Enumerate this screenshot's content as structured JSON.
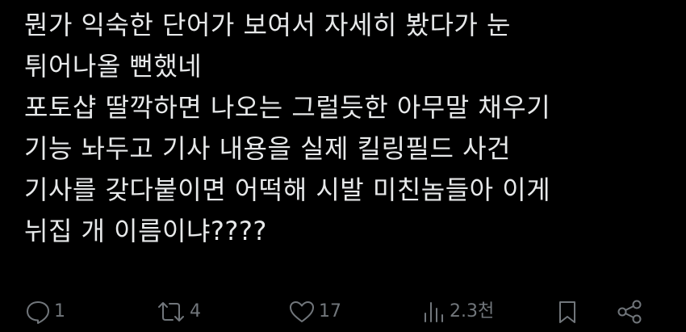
{
  "post": {
    "lines": [
      "뭔가 익숙한 단어가 보여서 자세히 봤다가 눈",
      "튀어나올 뻔했네",
      "포토샵 딸깍하면 나오는 그럴듯한 아무말 채우기",
      "기능 놔두고 기사 내용을 실제 킬링필드 사건",
      "기사를 갖다붙이면 어떡해 시발 미친놈들아 이게",
      "뉘집 개 이름이냐????"
    ]
  },
  "actions": {
    "reply": {
      "icon": "speech-bubble-icon",
      "count": "1"
    },
    "repost": {
      "icon": "repost-arrows-icon",
      "count": "4"
    },
    "like": {
      "icon": "heart-icon",
      "count": "17"
    },
    "views": {
      "icon": "bar-chart-icon",
      "count": "2.3천"
    },
    "bookmark": {
      "icon": "bookmark-icon"
    },
    "share": {
      "icon": "share-nodes-icon"
    }
  },
  "colors": {
    "background": "#000000",
    "text": "#e7e9ea",
    "muted": "#71767b"
  }
}
